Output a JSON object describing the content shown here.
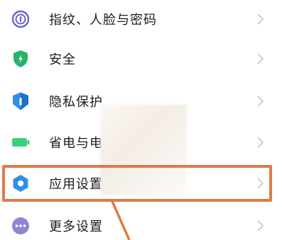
{
  "settings": {
    "items": [
      {
        "label": "指纹、人脸与密码",
        "icon": "fingerprint-icon",
        "color": "#6b63c9"
      },
      {
        "label": "安全",
        "icon": "shield-icon",
        "color": "#27b36b"
      },
      {
        "label": "隐私保护",
        "icon": "privacy-shield-icon",
        "color": "#2f8fe6"
      },
      {
        "label": "省电与电",
        "icon": "battery-icon",
        "color": "#3ccf7c"
      },
      {
        "label": "应用设置",
        "icon": "gear-icon",
        "color": "#2f8fe6"
      },
      {
        "label": "更多设置",
        "icon": "more-dots-icon",
        "color": "#8c87d4"
      }
    ]
  },
  "annotation": {
    "highlight_color": "#e07a47"
  }
}
